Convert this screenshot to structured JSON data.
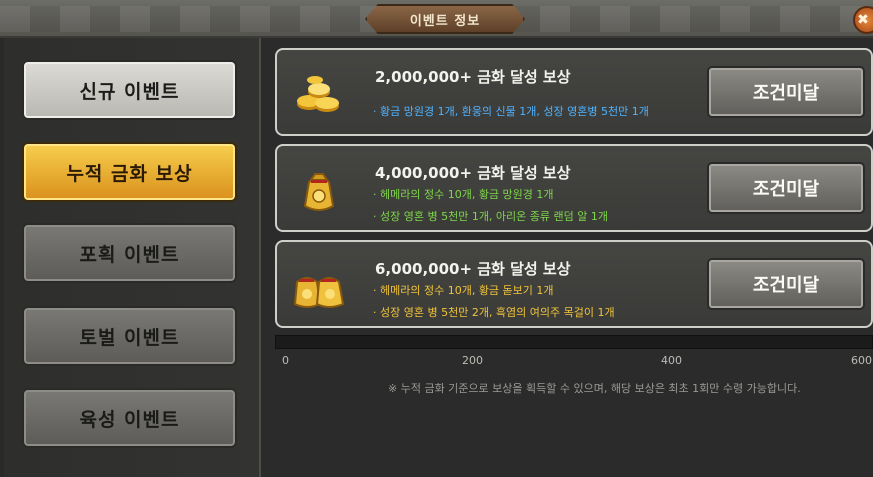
{
  "window": {
    "title": "이벤트 정보",
    "close_glyph": "✖"
  },
  "sidebar": {
    "items": [
      {
        "label": "신규 이벤트",
        "state": "normal"
      },
      {
        "label": "누적 금화 보상",
        "state": "active"
      },
      {
        "label": "포획 이벤트",
        "state": "normal"
      },
      {
        "label": "토벌 이벤트",
        "state": "normal"
      },
      {
        "label": "육성 이벤트",
        "state": "normal"
      }
    ]
  },
  "rewards": [
    {
      "title": "2,000,000+ 금화 달성 보상",
      "icon": "gold-coins-icon",
      "lines": [
        {
          "text": "· 황금 망원경 1개, 환웅의 신물 1개, 성장 영혼병 5천만 1개",
          "color": "#4fb3ff"
        }
      ],
      "button": "조건미달"
    },
    {
      "title": "4,000,000+ 금화 달성 보상",
      "icon": "gold-bag-icon",
      "lines": [
        {
          "text": "· 헤메라의 정수 10개, 황금 망원경 1개",
          "color": "#7fd84a"
        },
        {
          "text": "· 성장 영혼 병 5천만 1개, 아리온 종류 랜덤 알 1개",
          "color": "#7fd84a"
        }
      ],
      "button": "조건미달"
    },
    {
      "title": "6,000,000+ 금화 달성 보상",
      "icon": "gold-bags-icon",
      "lines": [
        {
          "text": "· 헤메라의 정수 10개, 황금 돋보기 1개",
          "color": "#f0c43a"
        },
        {
          "text": "· 성장 영혼 병 5천만 2개, 흑염의 여의주 목걸이 1개",
          "color": "#f0c43a"
        }
      ],
      "button": "조건미달"
    }
  ],
  "progress": {
    "value": 0,
    "ticks": [
      "0",
      "200",
      "400",
      "600"
    ]
  },
  "note": "※ 누적 금화 기준으로 보상을 획득할 수 있으며, 해당 보상은 최초 1회만 수령 가능합니다."
}
